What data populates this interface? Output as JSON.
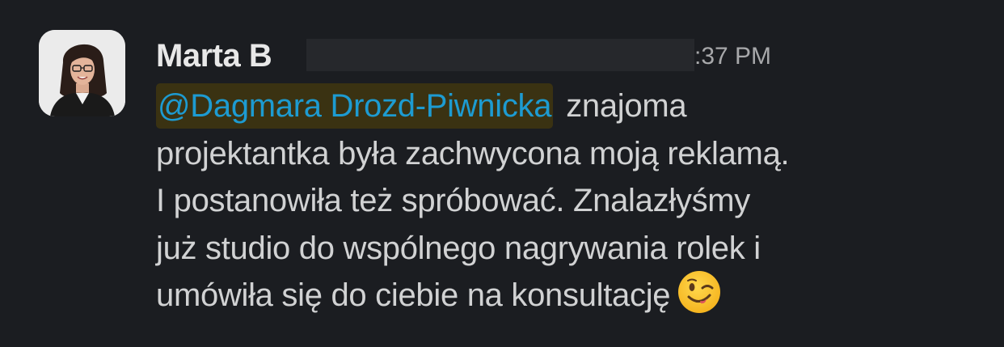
{
  "message": {
    "author": "Marta B",
    "timestamp": ":37 PM",
    "mention": "@Dagmara Drozd-Piwnicka",
    "lines": [
      "znajoma",
      "projektantka była zachwycona moją reklamą.",
      "I postanowiła też spróbować. Znalazłyśmy",
      "już studio do wspólnego nagrywania rolek  i",
      "umówiła się do ciebie na konsultację"
    ],
    "emoji": "winking-face-icon"
  }
}
